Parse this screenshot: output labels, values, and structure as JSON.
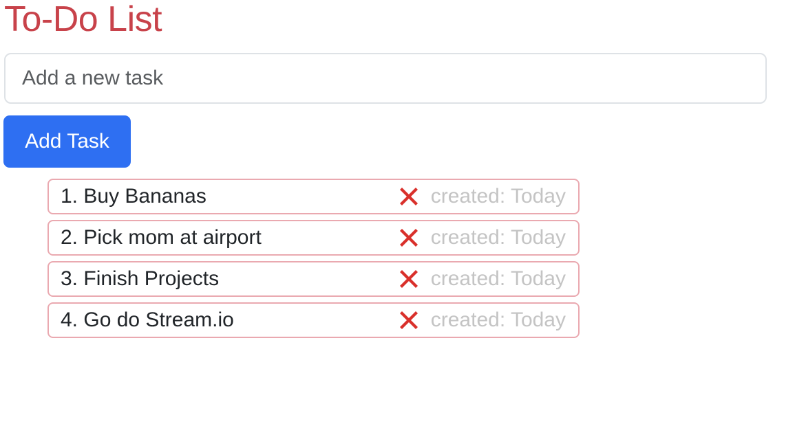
{
  "page": {
    "title": "To-Do List"
  },
  "form": {
    "input_placeholder": "Add a new task",
    "input_value": "",
    "add_button_label": "Add Task"
  },
  "tasks": [
    {
      "number": "1.",
      "text": "Buy Bananas",
      "created": "created: Today",
      "delete_icon": "cross-mark-icon"
    },
    {
      "number": "2.",
      "text": "Pick mom at airport",
      "created": "created: Today",
      "delete_icon": "cross-mark-icon"
    },
    {
      "number": "3.",
      "text": "Finish Projects",
      "created": "created: Today",
      "delete_icon": "cross-mark-icon"
    },
    {
      "number": "4.",
      "text": "Go do Stream.io",
      "created": "created: Today",
      "delete_icon": "cross-mark-icon"
    }
  ],
  "colors": {
    "title": "#c8424a",
    "button": "#2e6ff2",
    "task_border": "#eaa9b0",
    "delete_icon": "#d9302b",
    "created_text": "#c4c4c4"
  }
}
